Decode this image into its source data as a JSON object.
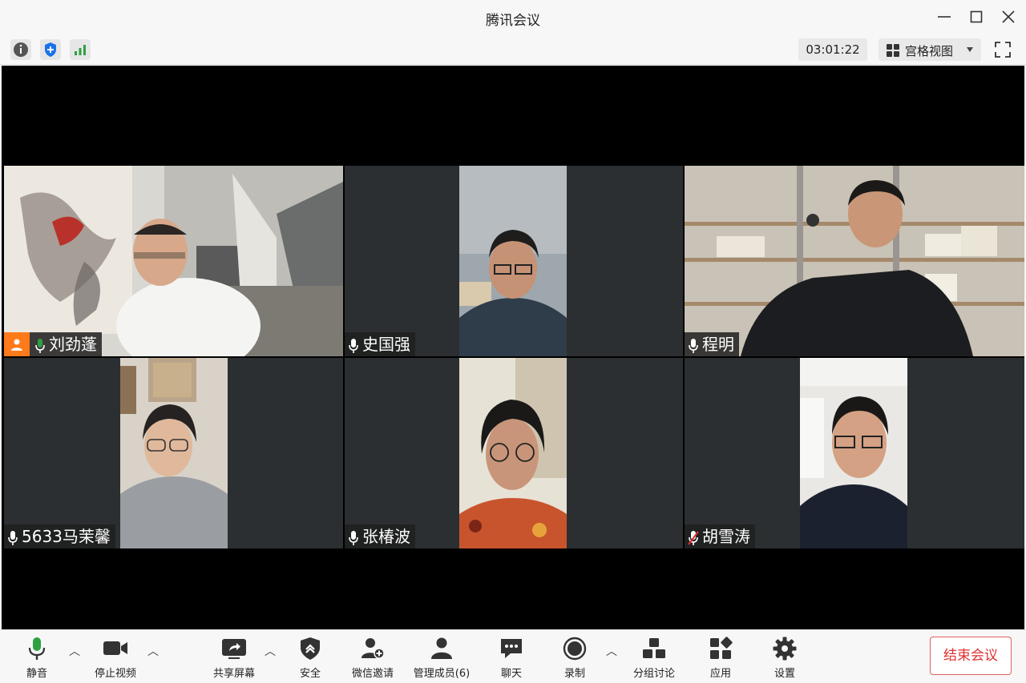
{
  "window": {
    "title": "腾讯会议"
  },
  "topbar": {
    "timer": "03:01:22",
    "view_label": "宫格视图"
  },
  "participants": [
    {
      "name": "刘劲蓬",
      "host": true,
      "mic": "active"
    },
    {
      "name": "史国强",
      "host": false,
      "mic": "on"
    },
    {
      "name": "程明",
      "host": false,
      "mic": "on"
    },
    {
      "name": "5633马茉馨",
      "host": false,
      "mic": "on"
    },
    {
      "name": "张椿波",
      "host": false,
      "mic": "on"
    },
    {
      "name": "胡雪涛",
      "host": false,
      "mic": "muted"
    }
  ],
  "toolbar": {
    "mute": "静音",
    "stop_video": "停止视频",
    "share_screen": "共享屏幕",
    "security": "安全",
    "wechat_invite": "微信邀请",
    "manage_members": "管理成员(6)",
    "chat": "聊天",
    "record": "录制",
    "breakout": "分组讨论",
    "apps": "应用",
    "settings": "设置",
    "end_meeting": "结束会议"
  },
  "colors": {
    "accent_green": "#2ea043",
    "end_red": "#e03030",
    "host_orange": "#ff7a1a"
  }
}
